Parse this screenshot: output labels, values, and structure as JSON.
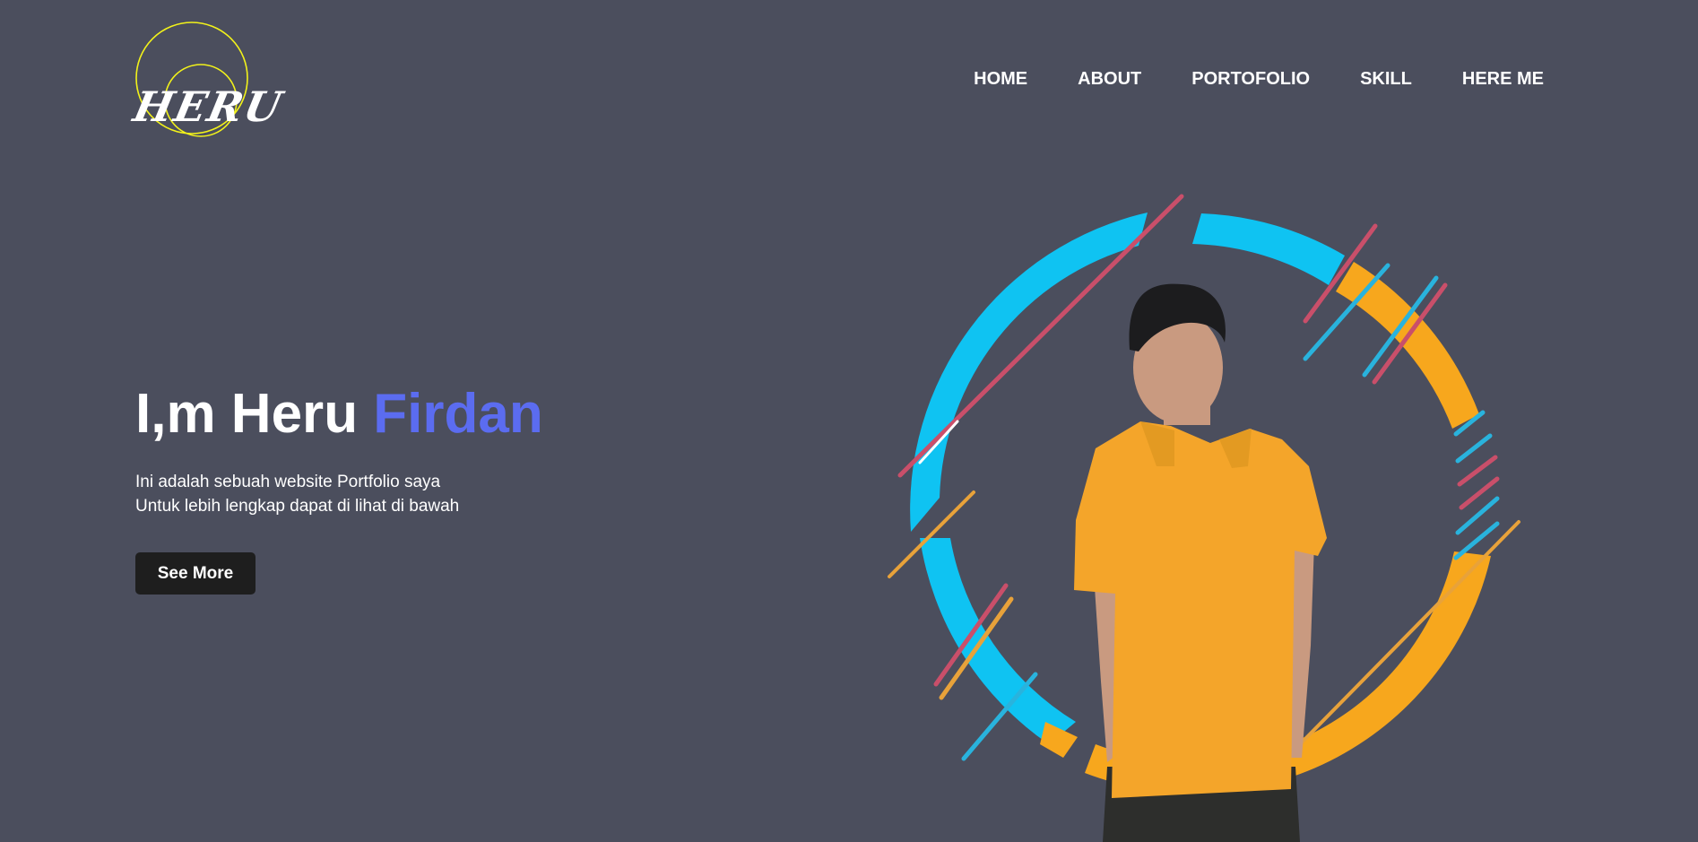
{
  "brand": {
    "logo_text": "HERU",
    "ring_color": "#f2f21a"
  },
  "nav": {
    "items": [
      {
        "label": "HOME"
      },
      {
        "label": "ABOUT"
      },
      {
        "label": "PORTOFOLIO"
      },
      {
        "label": "SKILL"
      },
      {
        "label": "HERE ME"
      }
    ]
  },
  "hero": {
    "title_prefix": "I,m Heru",
    "title_accent": "Firdan",
    "subtitle_line1": "Ini adalah sebuah website Portfolio saya",
    "subtitle_line2": "Untuk lebih lengkap dapat di lihat di bawah",
    "cta_label": "See More"
  },
  "colors": {
    "background": "#4b4e5d",
    "accent": "#5b6cf0",
    "ring_blue": "#0fc3f2",
    "ring_orange": "#f7a71d",
    "stripe_red": "#c94f6a",
    "button": "#1e1e1e",
    "shirt": "#f4a52a"
  }
}
